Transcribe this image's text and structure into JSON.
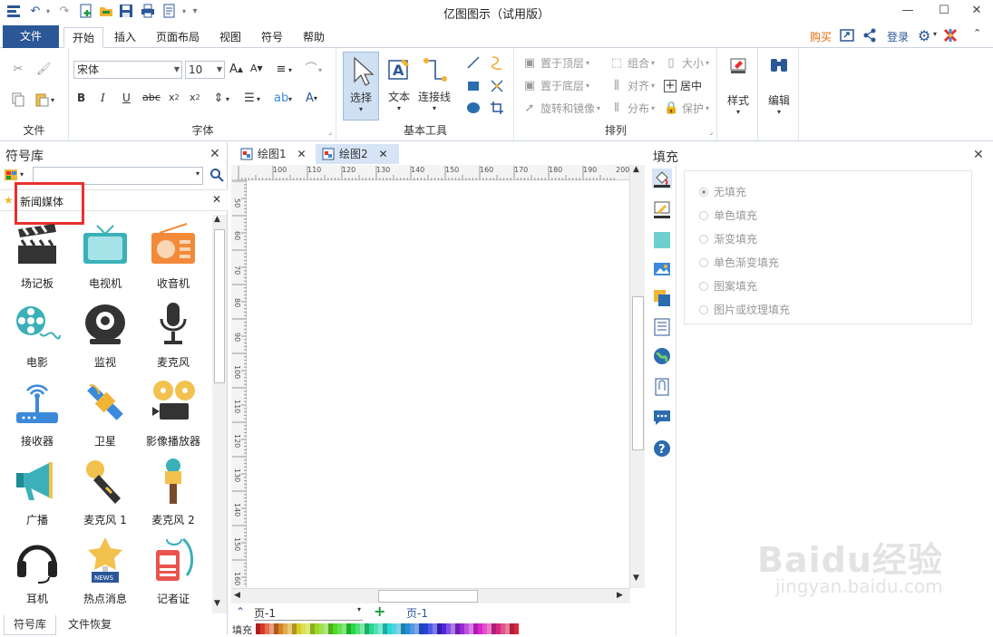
{
  "window": {
    "title": "亿图图示（试用版）"
  },
  "menu": {
    "file": "文件",
    "tabs": [
      "开始",
      "插入",
      "页面布局",
      "视图",
      "符号",
      "帮助"
    ],
    "buy": "购买",
    "login": "登录"
  },
  "ribbon": {
    "file_group": "文件",
    "font_group": "字体",
    "font_name": "宋体",
    "font_size": "10",
    "basic_tools_group": "基本工具",
    "select": "选择",
    "text": "文本",
    "connector": "连接线",
    "arrange_group": "排列",
    "bring_front": "置于顶层",
    "send_back": "置于底层",
    "rotate_mirror": "旋转和镜像",
    "group": "组合",
    "align": "对齐",
    "distribute": "分布",
    "size": "大小",
    "center": "居中",
    "protect": "保护",
    "style": "样式",
    "edit": "编辑"
  },
  "left_panel": {
    "title": "符号库",
    "category": "新闻媒体",
    "symbols": [
      "场记板",
      "电视机",
      "收音机",
      "电影",
      "监视",
      "麦克风",
      "接收器",
      "卫星",
      "影像播放器",
      "广播",
      "麦克风 1",
      "麦克风 2",
      "耳机",
      "热点消息",
      "记者证"
    ],
    "bottom_tabs": [
      "符号库",
      "文件恢复"
    ]
  },
  "doc_tabs": [
    "绘图1",
    "绘图2"
  ],
  "ruler": {
    "top_ticks": [
      "100",
      "110",
      "120",
      "130",
      "140",
      "150",
      "160",
      "170",
      "180",
      "190",
      "200"
    ],
    "left_ticks": [
      "50",
      "60",
      "70",
      "80",
      "90",
      "100",
      "110",
      "120",
      "130",
      "140",
      "150",
      "160"
    ]
  },
  "page_bar": {
    "page_select": "页-1",
    "current_page": "页-1"
  },
  "color_bar": {
    "label": "填充"
  },
  "fill_panel": {
    "title": "填充",
    "options": [
      "无填充",
      "单色填充",
      "渐变填充",
      "单色渐变填充",
      "图案填充",
      "图片或纹理填充"
    ],
    "selected_index": 0
  },
  "watermark": {
    "text": "Baidu经验",
    "url": "jingyan.baidu.com"
  },
  "colors": {
    "accent": "#2b5797",
    "highlight_box": "#e8312e",
    "buy": "#e36c09"
  }
}
